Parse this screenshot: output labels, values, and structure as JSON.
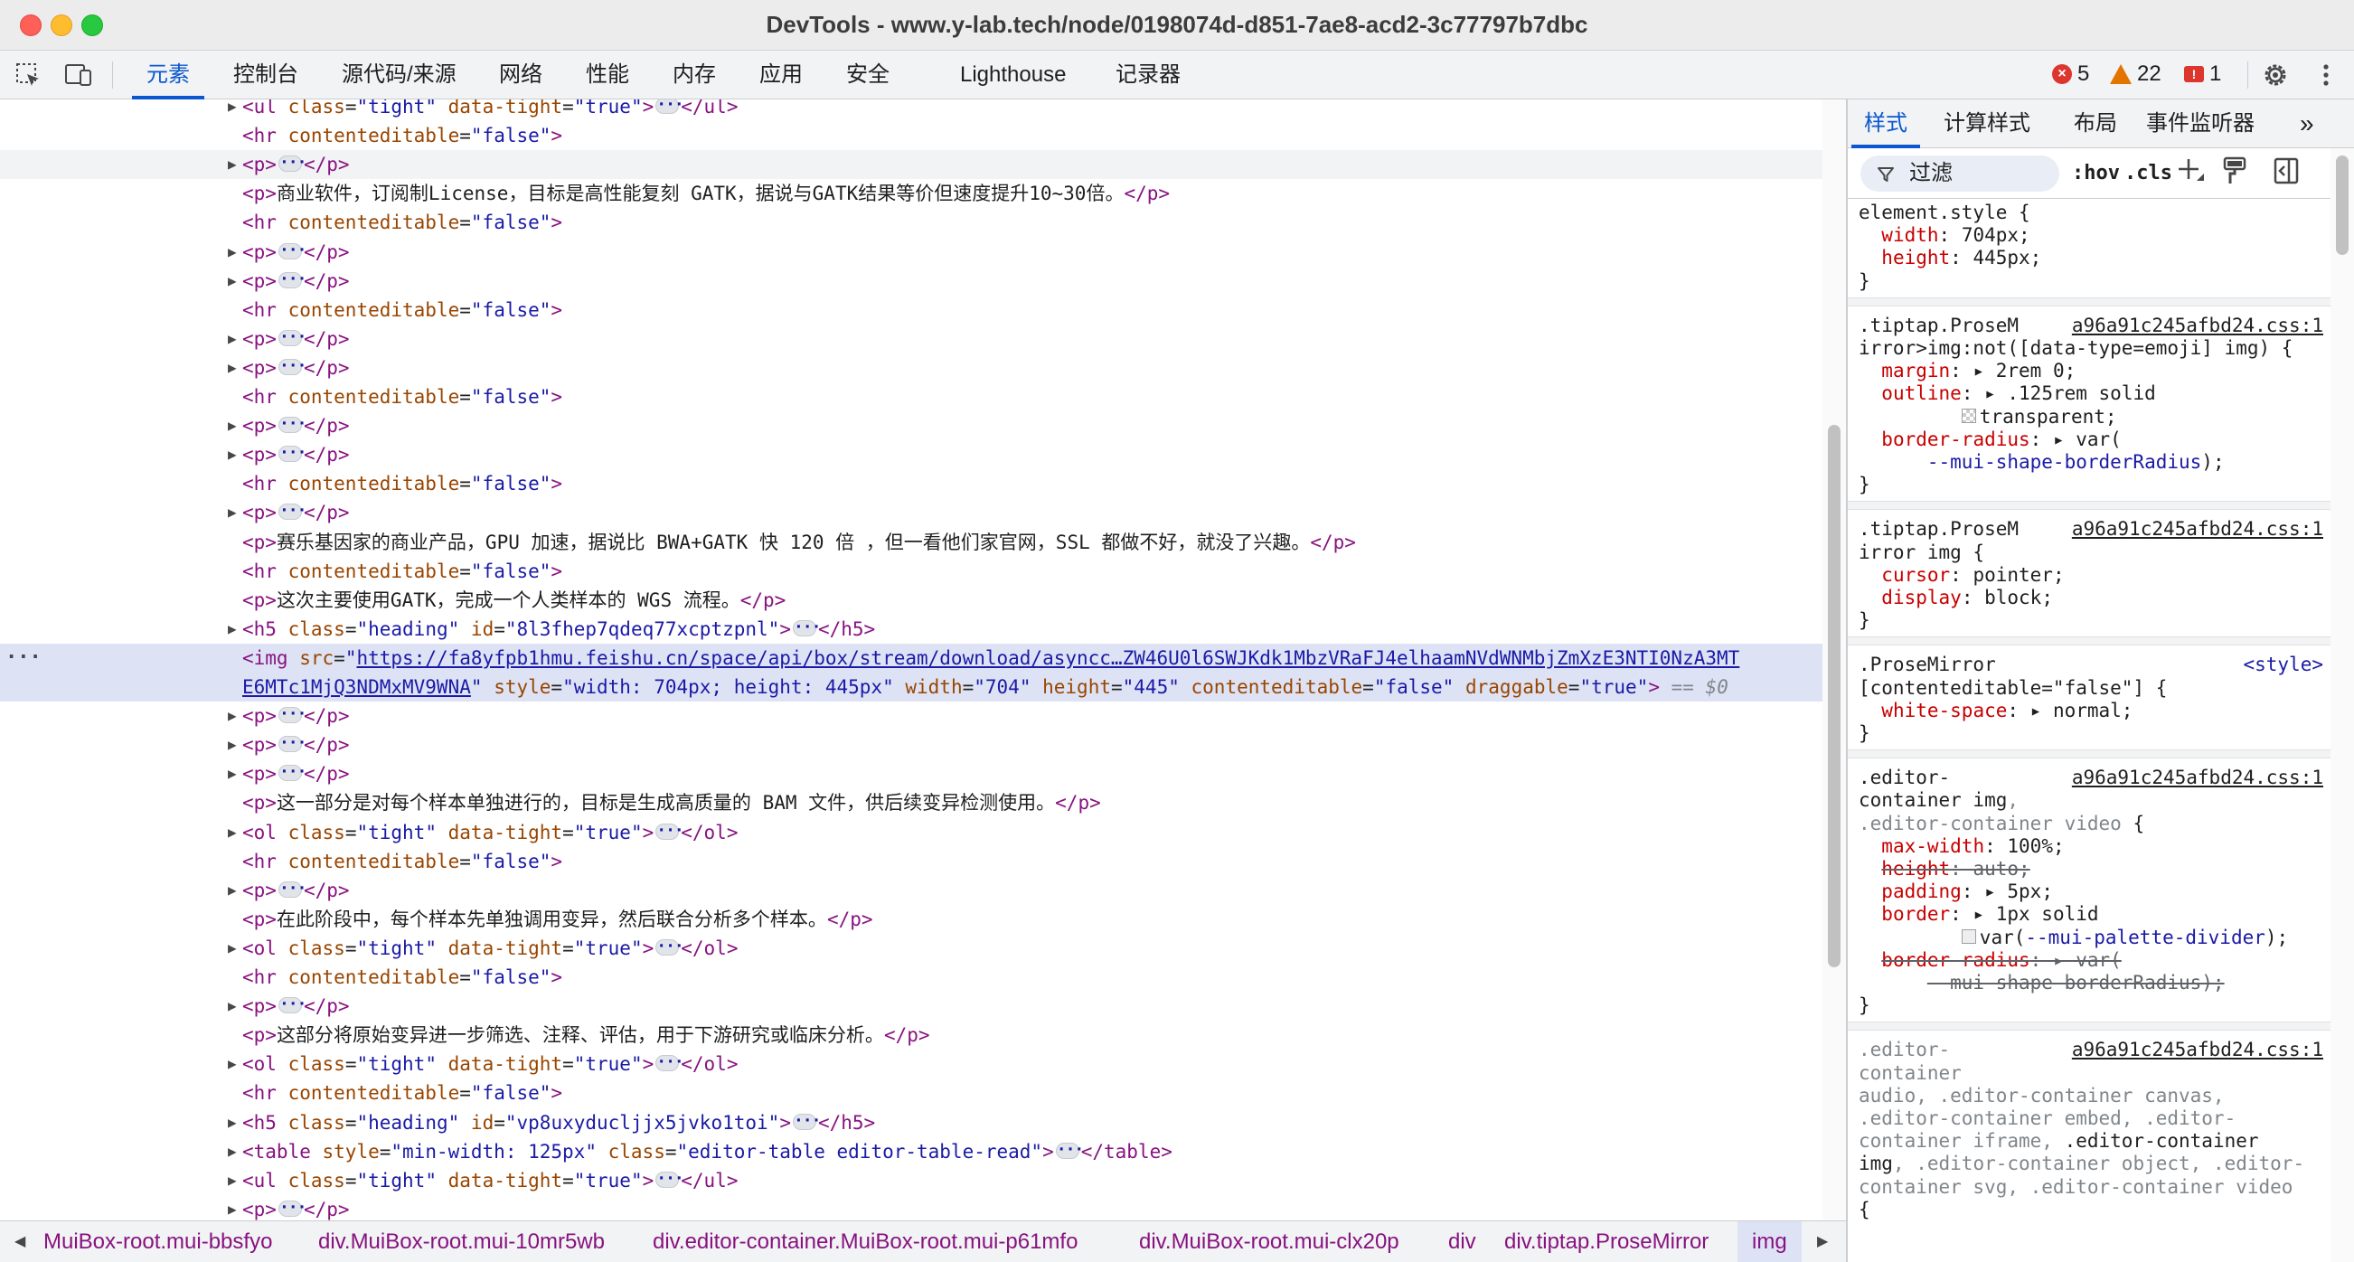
{
  "window": {
    "title": "DevTools - www.y-lab.tech/node/0198074d-d851-7ae8-acd2-3c77797b7dbc"
  },
  "toolbar": {
    "tabs": [
      "元素",
      "控制台",
      "源代码/来源",
      "网络",
      "性能",
      "内存",
      "应用",
      "安全",
      "Lighthouse",
      "记录器"
    ],
    "active_tab": "元素",
    "errors": "5",
    "warnings": "22",
    "issues": "1"
  },
  "elements": {
    "lines": [
      {
        "tri": true,
        "html": "<span class='tag'>&lt;ul</span> <span class='attr'>class</span>=<span class='val'>\"tight\"</span> <span class='attr'>data-tight</span>=<span class='val'>\"true\"</span><span class='tag'>&gt;</span><span class='ell'></span><span class='tag'>&lt;/ul&gt;</span>"
      },
      {
        "tri": false,
        "html": "<span class='tag'>&lt;hr</span> <span class='attr'>contenteditable</span>=<span class='val'>\"false\"</span><span class='tag'>&gt;</span>"
      },
      {
        "tri": true,
        "hover": true,
        "html": "<span class='tag'>&lt;p&gt;</span><span class='ell'></span><span class='tag'>&lt;/p&gt;</span>"
      },
      {
        "tri": false,
        "html": "<span class='tag'>&lt;p&gt;</span><span class='txt'>商业软件，订阅制License，目标是高性能复刻 GATK，据说与GATK结果等价但速度提升10~30倍。</span><span class='tag'>&lt;/p&gt;</span>"
      },
      {
        "tri": false,
        "html": "<span class='tag'>&lt;hr</span> <span class='attr'>contenteditable</span>=<span class='val'>\"false\"</span><span class='tag'>&gt;</span>"
      },
      {
        "tri": true,
        "html": "<span class='tag'>&lt;p&gt;</span><span class='ell'></span><span class='tag'>&lt;/p&gt;</span>"
      },
      {
        "tri": true,
        "html": "<span class='tag'>&lt;p&gt;</span><span class='ell'></span><span class='tag'>&lt;/p&gt;</span>"
      },
      {
        "tri": false,
        "html": "<span class='tag'>&lt;hr</span> <span class='attr'>contenteditable</span>=<span class='val'>\"false\"</span><span class='tag'>&gt;</span>"
      },
      {
        "tri": true,
        "html": "<span class='tag'>&lt;p&gt;</span><span class='ell'></span><span class='tag'>&lt;/p&gt;</span>"
      },
      {
        "tri": true,
        "html": "<span class='tag'>&lt;p&gt;</span><span class='ell'></span><span class='tag'>&lt;/p&gt;</span>"
      },
      {
        "tri": false,
        "html": "<span class='tag'>&lt;hr</span> <span class='attr'>contenteditable</span>=<span class='val'>\"false\"</span><span class='tag'>&gt;</span>"
      },
      {
        "tri": true,
        "html": "<span class='tag'>&lt;p&gt;</span><span class='ell'></span><span class='tag'>&lt;/p&gt;</span>"
      },
      {
        "tri": true,
        "html": "<span class='tag'>&lt;p&gt;</span><span class='ell'></span><span class='tag'>&lt;/p&gt;</span>"
      },
      {
        "tri": false,
        "html": "<span class='tag'>&lt;hr</span> <span class='attr'>contenteditable</span>=<span class='val'>\"false\"</span><span class='tag'>&gt;</span>"
      },
      {
        "tri": true,
        "html": "<span class='tag'>&lt;p&gt;</span><span class='ell'></span><span class='tag'>&lt;/p&gt;</span>"
      },
      {
        "tri": false,
        "html": "<span class='tag'>&lt;p&gt;</span><span class='txt'>赛乐基因家的商业产品，GPU 加速，据说比 BWA+GATK 快 120 倍 ，但一看他们家官网，SSL 都做不好，就没了兴趣。</span><span class='tag'>&lt;/p&gt;</span>"
      },
      {
        "tri": false,
        "html": "<span class='tag'>&lt;hr</span> <span class='attr'>contenteditable</span>=<span class='val'>\"false\"</span><span class='tag'>&gt;</span>"
      },
      {
        "tri": false,
        "html": "<span class='tag'>&lt;p&gt;</span><span class='txt'>这次主要使用GATK，完成一个人类样本的 WGS 流程。</span><span class='tag'>&lt;/p&gt;</span>"
      },
      {
        "tri": true,
        "html": "<span class='tag'>&lt;h5</span> <span class='attr'>class</span>=<span class='val'>\"heading\"</span> <span class='attr'>id</span>=<span class='val'>\"8l3fhep7qdeq77xcptzpnl\"</span><span class='tag'>&gt;</span><span class='ell'></span><span class='tag'>&lt;/h5&gt;</span>"
      },
      {
        "tri": false,
        "selected": true,
        "dots": true,
        "html": "<span class='tag'>&lt;img</span> <span class='attr'>src</span>=<span class='val'>\"</span><span class='link'>https://fa8yfpb1hmu.feishu.cn/space/api/box/stream/download/asyncc…ZW46U0l6SWJKdk1MbzVRaFJ4elhaamNVdWNMbjZmXzE3NTI0NzA3MT</span>"
      },
      {
        "tri": false,
        "selected": true,
        "cont": true,
        "html": "<span class='link'>E6MTc1MjQ3NDMxMV9WNA</span><span class='val'>\"</span> <span class='attr'>style</span>=<span class='val'>\"width: 704px; height: 445px\"</span> <span class='attr'>width</span>=<span class='val'>\"704\"</span> <span class='attr'>height</span>=<span class='val'>\"445\"</span> <span class='attr'>contenteditable</span>=<span class='val'>\"false\"</span> <span class='attr'>draggable</span>=<span class='val'>\"true\"</span><span class='tag'>&gt;</span> <span class='dim'>== $0</span>"
      },
      {
        "tri": true,
        "html": "<span class='tag'>&lt;p&gt;</span><span class='ell'></span><span class='tag'>&lt;/p&gt;</span>"
      },
      {
        "tri": true,
        "html": "<span class='tag'>&lt;p&gt;</span><span class='ell'></span><span class='tag'>&lt;/p&gt;</span>"
      },
      {
        "tri": true,
        "html": "<span class='tag'>&lt;p&gt;</span><span class='ell'></span><span class='tag'>&lt;/p&gt;</span>"
      },
      {
        "tri": false,
        "html": "<span class='tag'>&lt;p&gt;</span><span class='txt'>这一部分是对每个样本单独进行的，目标是生成高质量的 BAM 文件，供后续变异检测使用。</span><span class='tag'>&lt;/p&gt;</span>"
      },
      {
        "tri": true,
        "html": "<span class='tag'>&lt;ol</span> <span class='attr'>class</span>=<span class='val'>\"tight\"</span> <span class='attr'>data-tight</span>=<span class='val'>\"true\"</span><span class='tag'>&gt;</span><span class='ell'></span><span class='tag'>&lt;/ol&gt;</span>"
      },
      {
        "tri": false,
        "html": "<span class='tag'>&lt;hr</span> <span class='attr'>contenteditable</span>=<span class='val'>\"false\"</span><span class='tag'>&gt;</span>"
      },
      {
        "tri": true,
        "html": "<span class='tag'>&lt;p&gt;</span><span class='ell'></span><span class='tag'>&lt;/p&gt;</span>"
      },
      {
        "tri": false,
        "html": "<span class='tag'>&lt;p&gt;</span><span class='txt'>在此阶段中，每个样本先单独调用变异，然后联合分析多个样本。</span><span class='tag'>&lt;/p&gt;</span>"
      },
      {
        "tri": true,
        "html": "<span class='tag'>&lt;ol</span> <span class='attr'>class</span>=<span class='val'>\"tight\"</span> <span class='attr'>data-tight</span>=<span class='val'>\"true\"</span><span class='tag'>&gt;</span><span class='ell'></span><span class='tag'>&lt;/ol&gt;</span>"
      },
      {
        "tri": false,
        "html": "<span class='tag'>&lt;hr</span> <span class='attr'>contenteditable</span>=<span class='val'>\"false\"</span><span class='tag'>&gt;</span>"
      },
      {
        "tri": true,
        "html": "<span class='tag'>&lt;p&gt;</span><span class='ell'></span><span class='tag'>&lt;/p&gt;</span>"
      },
      {
        "tri": false,
        "html": "<span class='tag'>&lt;p&gt;</span><span class='txt'>这部分将原始变异进一步筛选、注释、评估，用于下游研究或临床分析。</span><span class='tag'>&lt;/p&gt;</span>"
      },
      {
        "tri": true,
        "html": "<span class='tag'>&lt;ol</span> <span class='attr'>class</span>=<span class='val'>\"tight\"</span> <span class='attr'>data-tight</span>=<span class='val'>\"true\"</span><span class='tag'>&gt;</span><span class='ell'></span><span class='tag'>&lt;/ol&gt;</span>"
      },
      {
        "tri": false,
        "html": "<span class='tag'>&lt;hr</span> <span class='attr'>contenteditable</span>=<span class='val'>\"false\"</span><span class='tag'>&gt;</span>"
      },
      {
        "tri": true,
        "html": "<span class='tag'>&lt;h5</span> <span class='attr'>class</span>=<span class='val'>\"heading\"</span> <span class='attr'>id</span>=<span class='val'>\"vp8uxyducljjx5jvko1toi\"</span><span class='tag'>&gt;</span><span class='ell'></span><span class='tag'>&lt;/h5&gt;</span>"
      },
      {
        "tri": true,
        "html": "<span class='tag'>&lt;table</span> <span class='attr'>style</span>=<span class='val'>\"min-width: 125px\"</span> <span class='attr'>class</span>=<span class='val'>\"editor-table editor-table-read\"</span><span class='tag'>&gt;</span><span class='ell'></span><span class='tag'>&lt;/table&gt;</span>"
      },
      {
        "tri": true,
        "html": "<span class='tag'>&lt;ul</span> <span class='attr'>class</span>=<span class='val'>\"tight\"</span> <span class='attr'>data-tight</span>=<span class='val'>\"true\"</span><span class='tag'>&gt;</span><span class='ell'></span><span class='tag'>&lt;/ul&gt;</span>"
      },
      {
        "tri": true,
        "html": "<span class='tag'>&lt;p&gt;</span><span class='ell'></span><span class='tag'>&lt;/p&gt;</span>"
      }
    ]
  },
  "breadcrumbs": {
    "items": [
      "MuiBox-root.mui-bbsfyo",
      "div.MuiBox-root.mui-10mr5wb",
      "div.editor-container.MuiBox-root.mui-p61mfo",
      "div.MuiBox-root.mui-clx20p",
      "div",
      "div.tiptap.ProseMirror",
      "img"
    ]
  },
  "styles_panel": {
    "tabs": [
      "样式",
      "计算样式",
      "布局",
      "事件监听器"
    ],
    "filter_label": "过滤",
    "hov": ":hov",
    "cls": ".cls",
    "lines": [
      {
        "t": "<span class='sel'>element.style {</span>"
      },
      {
        "t": "&nbsp;&nbsp;<span class='prop'>width</span>: <span class='pval'>704px;</span>"
      },
      {
        "t": "&nbsp;&nbsp;<span class='prop'>height</span>: <span class='pval'>445px;</span>"
      },
      {
        "t": "<span class='sel'>}</span>"
      },
      {
        "sep": true
      },
      {
        "src": "a96a91c245afbd24.css:1"
      },
      {
        "t": "<span class='sel'>.tiptap.ProseM</span>"
      },
      {
        "t": "<span class='sel'>irror&gt;img:not([data-type=emoji] img) {</span>"
      },
      {
        "t": "&nbsp;&nbsp;<span class='prop'>margin</span>: ▸ <span class='pval'>2rem 0;</span>"
      },
      {
        "t": "&nbsp;&nbsp;<span class='prop'>outline</span>: ▸ <span class='pval'>.125rem solid</span>"
      },
      {
        "t": "&nbsp;&nbsp;&nbsp;&nbsp;&nbsp;&nbsp;&nbsp;&nbsp;&nbsp;<span class='swatch'></span><span class='pval'>transparent;</span>"
      },
      {
        "t": "&nbsp;&nbsp;<span class='prop'>border-radius</span>: ▸ <span class='pval'>var(</span>"
      },
      {
        "t": "&nbsp;&nbsp;&nbsp;&nbsp;&nbsp;&nbsp;<span class='pval-blue'>--mui-shape-borderRadius</span><span class='pval'>);</span>"
      },
      {
        "t": "<span class='sel'>}</span>"
      },
      {
        "sep": true
      },
      {
        "src": "a96a91c245afbd24.css:1"
      },
      {
        "t": "<span class='sel'>.tiptap.ProseM</span>"
      },
      {
        "t": "<span class='sel'>irror img {</span>"
      },
      {
        "t": "&nbsp;&nbsp;<span class='prop'>cursor</span>: <span class='pval'>pointer;</span>"
      },
      {
        "t": "&nbsp;&nbsp;<span class='prop'>display</span>: <span class='pval'>block;</span>"
      },
      {
        "t": "<span class='sel'>}</span>"
      },
      {
        "sep": true
      },
      {
        "src": "&lt;style&gt;",
        "blue": true
      },
      {
        "t": "<span class='sel'>.ProseMirror</span>"
      },
      {
        "t": "<span class='sel'>[contenteditable=\"false\"] {</span>"
      },
      {
        "t": "&nbsp;&nbsp;<span class='prop'>white-space</span>: ▸ <span class='pval'>normal;</span>"
      },
      {
        "t": "<span class='sel'>}</span>"
      },
      {
        "sep": true
      },
      {
        "src": "a96a91c245afbd24.css:1"
      },
      {
        "t": "<span class='sel'>.editor-</span>"
      },
      {
        "t": "<span class='sel'>container img</span><span class='sel-dim'>,</span>"
      },
      {
        "t": "<span class='sel-dim'>.editor-container video</span> <span class='sel'>{</span>"
      },
      {
        "t": "&nbsp;&nbsp;<span class='prop'>max-width</span>: <span class='pval'>100%;</span>"
      },
      {
        "t": "&nbsp;&nbsp;<span class='strike'><span class='prop'>height</span>: auto;</span>"
      },
      {
        "t": "&nbsp;&nbsp;<span class='prop'>padding</span>: ▸ <span class='pval'>5px;</span>"
      },
      {
        "t": "&nbsp;&nbsp;<span class='prop'>border</span>: ▸ <span class='pval'>1px solid</span>"
      },
      {
        "t": "&nbsp;&nbsp;&nbsp;&nbsp;&nbsp;&nbsp;&nbsp;&nbsp;&nbsp;<span class='swatch solid'></span><span class='pval'>var(</span><span class='pval-blue'>--mui-palette-divider</span><span class='pval'>);</span>"
      },
      {
        "t": "&nbsp;&nbsp;<span class='strike'><span class='prop'>border-radius</span>: ▸ var(</span>"
      },
      {
        "t": "&nbsp;&nbsp;&nbsp;&nbsp;&nbsp;&nbsp;<span class='strike'>--mui-shape-borderRadius);</span>"
      },
      {
        "t": "<span class='sel'>}</span>"
      },
      {
        "sep": true
      },
      {
        "src": "a96a91c245afbd24.css:1"
      },
      {
        "t": "<span class='sel-dim'>.editor-</span>"
      },
      {
        "t": "<span class='sel-dim'>container</span>"
      },
      {
        "t": "<span class='sel-dim'>audio, .editor-container canvas,</span>"
      },
      {
        "t": "<span class='sel-dim'>.editor-container embed, .editor-</span>"
      },
      {
        "t": "<span class='sel-dim'>container iframe, </span><span class='sel'>.editor-container</span>"
      },
      {
        "t": "<span class='sel'>img</span><span class='sel-dim'>, .editor-container object, .editor-</span>"
      },
      {
        "t": "<span class='sel-dim'>container svg, .editor-container video</span>"
      },
      {
        "t": "<span class='sel'>{</span>"
      }
    ]
  }
}
